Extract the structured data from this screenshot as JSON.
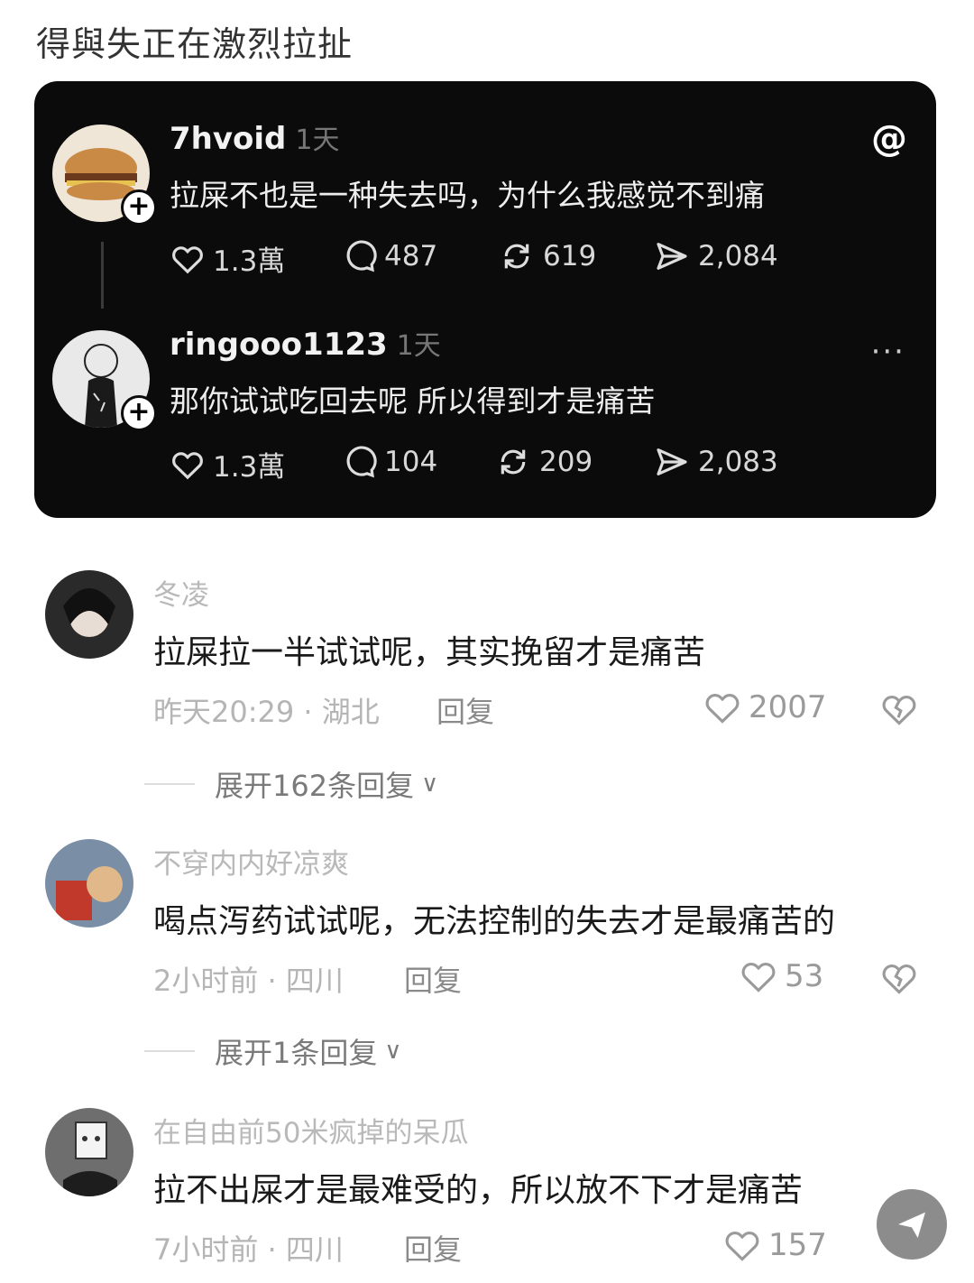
{
  "page_title": "得與失正在激烈拉扯",
  "threads_card": {
    "posts": [
      {
        "username": "7hvoid",
        "time": "1天",
        "text": "拉屎不也是一种失去吗，为什么我感觉不到痛",
        "likes": "1.3萬",
        "comments": "487",
        "reposts": "619",
        "shares": "2,084"
      },
      {
        "username": "ringooo1123",
        "time": "1天",
        "text": "那你试试吃回去呢 所以得到才是痛苦",
        "likes": "1.3萬",
        "comments": "104",
        "reposts": "209",
        "shares": "2,083"
      }
    ],
    "more": "···"
  },
  "comments": [
    {
      "username": "冬凌",
      "text": "拉屎拉一半试试呢，其实挽留才是痛苦",
      "meta": "昨天20:29 · 湖北",
      "reply": "回复",
      "likes": "2007",
      "expand": "展开162条回复"
    },
    {
      "username": "不穿内内好凉爽",
      "text": "喝点泻药试试呢，无法控制的失去才是最痛苦的",
      "meta": "2小时前 · 四川",
      "reply": "回复",
      "likes": "53",
      "expand": "展开1条回复"
    },
    {
      "username": "在自由前50米疯掉的呆瓜",
      "text": "拉不出屎才是最难受的，所以放不下才是痛苦",
      "meta": "7小时前 · 四川",
      "reply": "回复",
      "likes": "157"
    }
  ],
  "colors": {
    "card_bg": "#0b0b0b",
    "meta_text": "#b5b5b5"
  }
}
